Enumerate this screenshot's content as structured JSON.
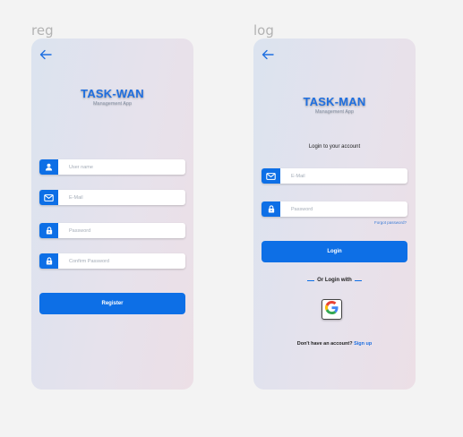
{
  "reg": {
    "frame_label": "reg",
    "brand_title": "TASK-WAN",
    "brand_subtitle": "Management App",
    "fields": {
      "username_placeholder": "User name",
      "email_placeholder": "E-Mail",
      "password_placeholder": "Password",
      "confirm_placeholder": "Confirm Password"
    },
    "register_label": "Register"
  },
  "log": {
    "frame_label": "log",
    "brand_title": "TASK-MAN",
    "brand_subtitle": "Management App",
    "heading": "Login to your account",
    "fields": {
      "email_placeholder": "E-Mail",
      "password_placeholder": "Password"
    },
    "forgot_label": "Forgot password?",
    "login_label": "Login",
    "divider_label": "Or Login with",
    "signup_prompt": "Don't have an account?",
    "signup_link": "Sign up"
  },
  "colors": {
    "accent": "#0d6fe6",
    "brand_text": "#1f6fe0",
    "background": "#f3f3f3"
  },
  "icons": [
    "arrow-left-icon",
    "user-icon",
    "mail-icon",
    "lock-icon",
    "google-icon"
  ]
}
